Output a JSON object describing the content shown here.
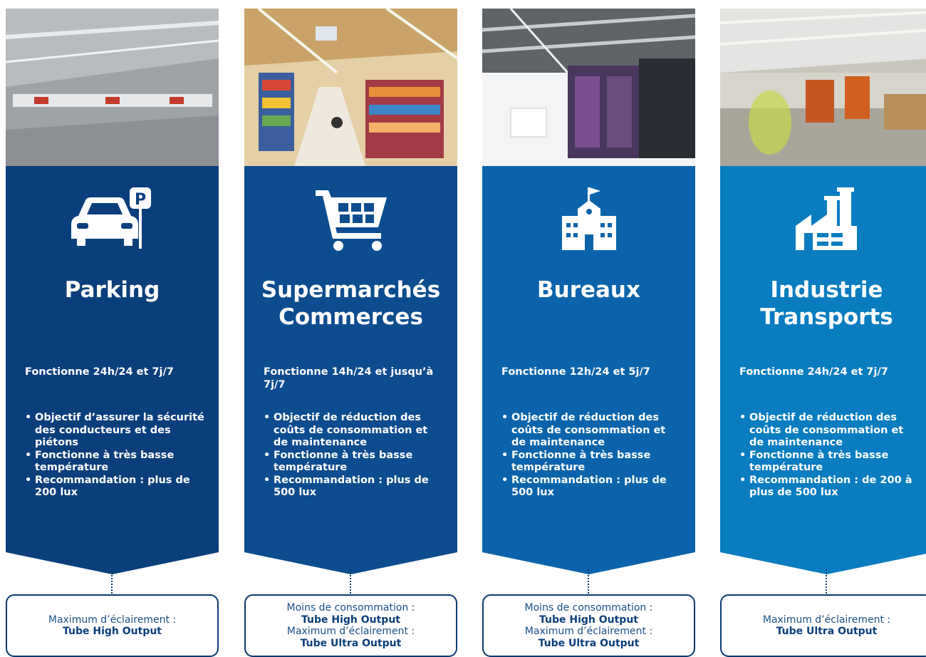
{
  "columns": [
    {
      "title_lines": [
        "Parking"
      ],
      "icon": "parking-car-icon",
      "color": "#0b3f7c",
      "hours": "Fonctionne 24h/24 et 7j/7",
      "bullets": [
        "Objectif d’assurer la sécurité des conducteurs et des piétons",
        "Fonctionne à très basse température",
        "Recommandation : plus de 200 lux"
      ],
      "box": [
        {
          "label": "Maximum d’éclairement :",
          "product": "Tube High Output"
        }
      ]
    },
    {
      "title_lines": [
        "Supermarchés",
        "Commerces"
      ],
      "icon": "shopping-cart-icon",
      "color": "#0d4c8e",
      "hours": "Fonctionne 14h/24 et jusqu’à 7j/7",
      "bullets": [
        "Objectif de réduction des coûts de consommation et de maintenance",
        "Fonctionne à très basse température",
        "Recommandation : plus de 500 lux"
      ],
      "box": [
        {
          "label": "Moins de consommation :",
          "product": "Tube High Output"
        },
        {
          "label": "Maximum d’éclairement :",
          "product": "Tube Ultra Output"
        }
      ]
    },
    {
      "title_lines": [
        "Bureaux"
      ],
      "icon": "office-building-icon",
      "color": "#0b64ab",
      "hours": "Fonctionne 12h/24 et 5j/7",
      "bullets": [
        "Objectif de réduction des coûts de consommation et de maintenance",
        "Fonctionne à très basse température",
        "Recommandation : plus de 500 lux"
      ],
      "box": [
        {
          "label": "Moins de consommation :",
          "product": "Tube High Output"
        },
        {
          "label": "Maximum d’éclairement :",
          "product": "Tube Ultra Output"
        }
      ]
    },
    {
      "title_lines": [
        "Industrie",
        "Transports"
      ],
      "icon": "factory-icon",
      "color": "#0a7cc0",
      "hours": "Fonctionne 24h/24 et 7j/7",
      "bullets": [
        "Objectif de réduction des coûts de consommation et de maintenance",
        "Fonctionne à très basse température",
        "Recommandation : de 200 à plus de 500 lux"
      ],
      "box": [
        {
          "label": "Maximum d’éclairement :",
          "product": "Tube Ultra Output"
        }
      ]
    }
  ]
}
